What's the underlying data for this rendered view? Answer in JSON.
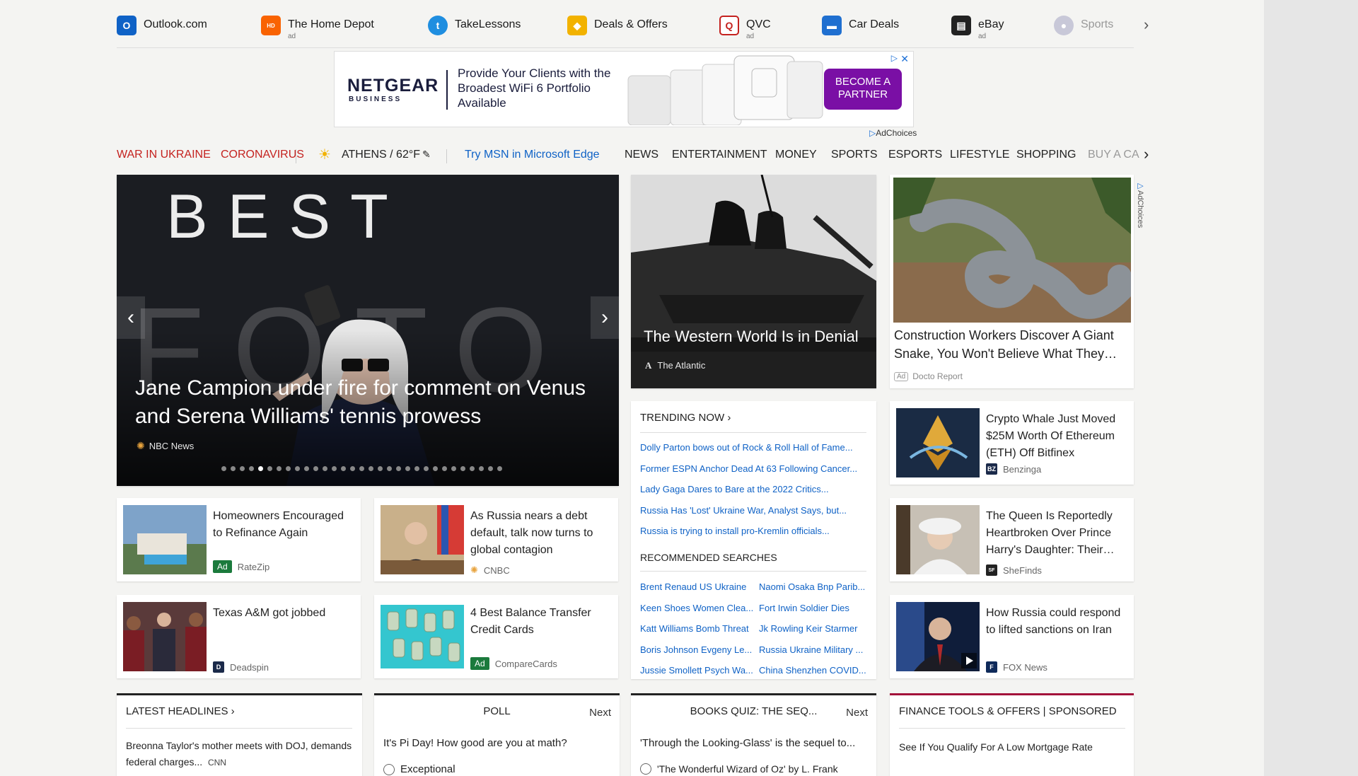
{
  "quicklinks": [
    {
      "label": "Outlook.com",
      "icon": "outlook-icon",
      "color": "#0f62c6",
      "ad": ""
    },
    {
      "label": "The Home Depot",
      "icon": "home-depot-icon",
      "color": "#f96302",
      "ad": "ad"
    },
    {
      "label": "TakeLessons",
      "icon": "takelessons-icon",
      "color": "#1f8ee0",
      "ad": ""
    },
    {
      "label": "Deals & Offers",
      "icon": "tag-icon",
      "color": "#f2b200",
      "ad": ""
    },
    {
      "label": "QVC",
      "icon": "qvc-icon",
      "color": "#c4221f",
      "ad": "ad"
    },
    {
      "label": "Car Deals",
      "icon": "car-icon",
      "color": "#1f6fd0",
      "ad": ""
    },
    {
      "label": "eBay",
      "icon": "shopping-bag-icon",
      "color": "#222222",
      "ad": "ad"
    },
    {
      "label": "Sports",
      "icon": "sports-icon",
      "color": "#b8b8c8",
      "ad": ""
    }
  ],
  "banner": {
    "brand": "NETGEAR",
    "brand_sub": "BUSINESS",
    "copy": "Provide Your Clients with the Broadest WiFi 6 Portfolio Available",
    "cta": "BECOME A PARTNER",
    "close": "✕",
    "adchoices_icon": "▷",
    "adchoices": "AdChoices"
  },
  "nav": {
    "war": "WAR IN UKRAINE",
    "corona": "CORONAVIRUS",
    "weather": "ATHENS / 62°F",
    "edge": "Try MSN in Microsoft Edge",
    "tabs": [
      "NEWS",
      "ENTERTAINMENT",
      "MONEY",
      "SPORTS",
      "ESPORTS",
      "LIFESTYLE",
      "SHOPPING"
    ],
    "more": "BUY A CA"
  },
  "hero": {
    "bg_word": "BEST",
    "bg_word2": "FOTO",
    "title": "Jane Campion under fire for comment on Venus and Serena Williams' tennis prowess",
    "source": "NBC News",
    "dot_count": 31,
    "active_dot": 4
  },
  "tank": {
    "title": "The Western World Is in Denial",
    "source": "The Atlantic"
  },
  "snake": {
    "title": "Construction Workers Discover A Giant Snake, You Won't Believe What They…",
    "ad": "Ad",
    "source": "Docto Report",
    "adchoices": "AdChoices"
  },
  "cards": {
    "refinance": {
      "title": "Homeowners Encouraged to Refinance Again",
      "ad": "Ad",
      "source": "RateZip"
    },
    "russia_debt": {
      "title": "As Russia nears a debt default, talk now turns to global contagion",
      "source": "CNBC"
    },
    "crypto": {
      "title": "Crypto Whale Just Moved $25M Worth Of Ethereum (ETH) Off Bitfinex",
      "source_icon": "BZ",
      "source": "Benzinga"
    },
    "tamu": {
      "title": "Texas A&M got jobbed",
      "source": "Deadspin"
    },
    "balance": {
      "title": "4 Best Balance Transfer Credit Cards",
      "ad": "Ad",
      "source": "CompareCards"
    },
    "queen": {
      "title": "The Queen Is Reportedly Heartbroken Over Prince Harry's Daughter: Their…",
      "source": "SheFinds"
    },
    "iran": {
      "title": "How Russia could respond to lifted sanctions on Iran",
      "source": "FOX News"
    }
  },
  "trending": {
    "head": "TRENDING NOW",
    "items": [
      "Dolly Parton bows out of Rock & Roll Hall of Fame...",
      "Former ESPN Anchor Dead At 63 Following Cancer...",
      "Lady Gaga Dares to Bare at the 2022 Critics...",
      "Russia Has 'Lost' Ukraine War, Analyst Says, but...",
      "Russia is trying to install pro-Kremlin officials..."
    ],
    "rec_head": "RECOMMENDED SEARCHES",
    "searches": [
      [
        "Brent Renaud US Ukraine",
        "Naomi Osaka Bnp Parib..."
      ],
      [
        "Keen Shoes Women Clea...",
        "Fort Irwin Soldier Dies"
      ],
      [
        "Katt Williams Bomb Threat",
        "Jk Rowling Keir Starmer"
      ],
      [
        "Boris Johnson Evgeny Le...",
        "Russia Ukraine Military ..."
      ],
      [
        "Jussie Smollett Psych Wa...",
        "China Shenzhen COVID..."
      ]
    ]
  },
  "bottom": {
    "latest": {
      "head": "LATEST HEADLINES",
      "text": "Breonna Taylor's mother meets with DOJ, demands federal charges...",
      "source": "CNN"
    },
    "poll": {
      "head": "POLL",
      "next": "Next",
      "question": "It's Pi Day! How good are you at math?",
      "option": "Exceptional"
    },
    "quiz": {
      "head": "BOOKS QUIZ: THE SEQ...",
      "next": "Next",
      "question": "'Through the Looking-Glass' is the sequel to...",
      "option": "'The Wonderful Wizard of Oz' by L. Frank"
    },
    "finance": {
      "head": "FINANCE TOOLS & OFFERS | SPONSORED",
      "text": "See If You Qualify For A Low Mortgage Rate"
    }
  },
  "colors": {
    "accent_red": "#c4221f",
    "link_blue": "#0f62c6",
    "ad_green": "#1b7a3c",
    "cta_purple": "#7a0fa5",
    "finance_bar": "#a3123a"
  }
}
